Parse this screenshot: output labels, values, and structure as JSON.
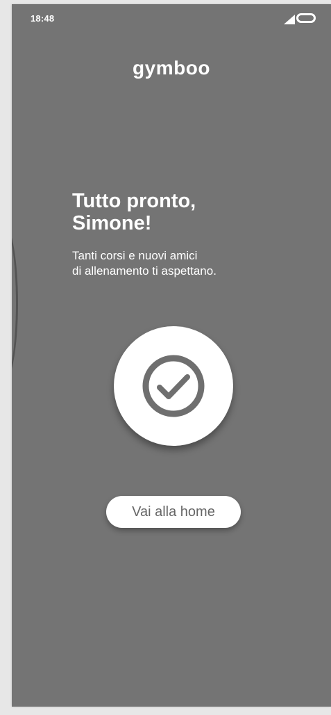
{
  "status_bar": {
    "time": "18:48",
    "icons": [
      "signal-icon",
      "battery-icon"
    ]
  },
  "brand": {
    "logo_text": "gymboo"
  },
  "main": {
    "title": "Tutto pronto,\nSimone!",
    "subtitle": "Tanti corsi e nuovi amici\ndi allenamento ti aspettano.",
    "status_icon": "check-circle-icon",
    "home_button_label": "Vai alla home"
  },
  "colors": {
    "background": "#747474",
    "canvas": "#e7e7e7",
    "foreground": "#ffffff",
    "button_text": "#666666",
    "icon": "#6f6f6f"
  }
}
